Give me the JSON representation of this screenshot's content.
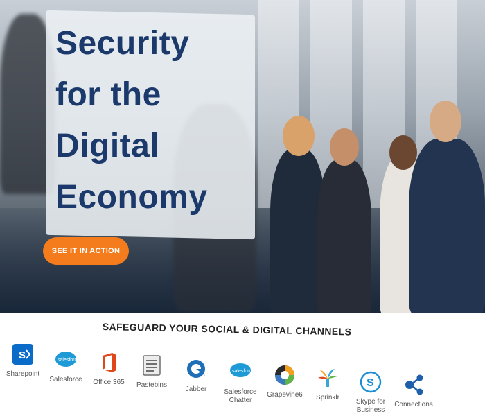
{
  "hero": {
    "headline": "Security for the Digital Economy",
    "cta_label": "SEE IT IN ACTION"
  },
  "channels_section": {
    "title": "SAFEGUARD YOUR SOCIAL & DIGITAL CHANNELS",
    "items": [
      {
        "label": "Sharepoint",
        "icon": "sharepoint-icon",
        "color": "#0b6bc9"
      },
      {
        "label": "Salesforce",
        "icon": "salesforce-icon",
        "color": "#1e9bd7",
        "icon_text": "salesforce"
      },
      {
        "label": "Office 365",
        "icon": "office365-icon",
        "color": "#e0461b"
      },
      {
        "label": "Pastebins",
        "icon": "pastebins-icon",
        "color": "#6f6f6f"
      },
      {
        "label": "Jabber",
        "icon": "jabber-icon",
        "color": "#1e6fb8"
      },
      {
        "label": "Salesforce Chatter",
        "icon": "salesforce-chatter-icon",
        "color": "#1e9bd7",
        "icon_text": "salesforce"
      },
      {
        "label": "Grapevine6",
        "icon": "grapevine6-icon",
        "color": "#2b2b2b"
      },
      {
        "label": "Sprinklr",
        "icon": "sprinklr-icon",
        "color": "#3aa6d8"
      },
      {
        "label": "Skype for Business",
        "icon": "skype-icon",
        "color": "#1a8fd6"
      },
      {
        "label": "Connections",
        "icon": "connections-icon",
        "color": "#1d5fa8"
      }
    ]
  }
}
